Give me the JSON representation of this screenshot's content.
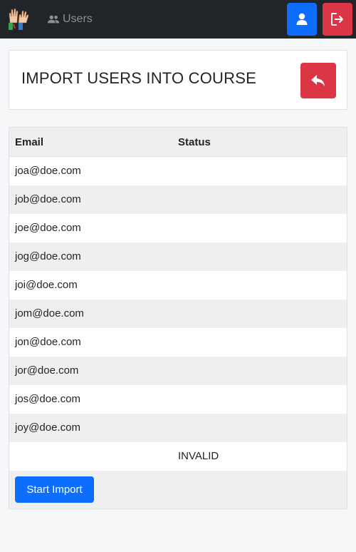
{
  "nav": {
    "users_label": "Users"
  },
  "header": {
    "title": "IMPORT USERS INTO COURSE"
  },
  "table": {
    "columns": [
      "Email",
      "Status"
    ],
    "rows": [
      {
        "email": "joa@doe.com",
        "status": ""
      },
      {
        "email": "job@doe.com",
        "status": ""
      },
      {
        "email": "joe@doe.com",
        "status": ""
      },
      {
        "email": "jog@doe.com",
        "status": ""
      },
      {
        "email": "joi@doe.com",
        "status": ""
      },
      {
        "email": "jom@doe.com",
        "status": ""
      },
      {
        "email": "jon@doe.com",
        "status": ""
      },
      {
        "email": "jor@doe.com",
        "status": ""
      },
      {
        "email": "jos@doe.com",
        "status": ""
      },
      {
        "email": "joy@doe.com",
        "status": ""
      },
      {
        "email": "",
        "status": "INVALID"
      }
    ]
  },
  "actions": {
    "start_import_label": "Start Import"
  },
  "colors": {
    "primary": "#0d6efd",
    "danger": "#dc3545",
    "navbar": "#212529"
  },
  "icons": {
    "logo": "raised-hands-logo",
    "users": "users-icon",
    "profile": "user-icon",
    "logout": "logout-icon",
    "back": "reply-arrow-icon"
  }
}
